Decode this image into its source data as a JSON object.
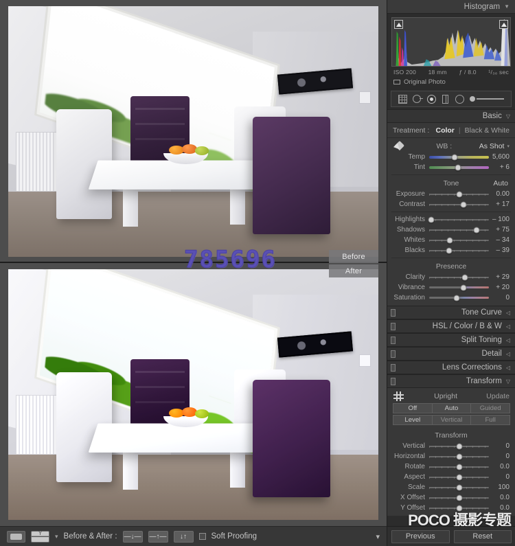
{
  "histogram": {
    "title": "Histogram",
    "collapse_icon": "triangle-down-icon",
    "clip_shadow_icon": "shadow-clipping-icon",
    "clip_highlight_icon": "highlight-clipping-icon",
    "exif": {
      "iso": "ISO 200",
      "focal_length": "18 mm",
      "aperture": "ƒ / 8.0",
      "shutter": "¹/₃₆ sec"
    },
    "original_photo_label": "Original Photo",
    "original_photo_icon": "rectangle-icon"
  },
  "tool_strip": [
    {
      "name": "crop-overlay-icon",
      "glyph": "grid"
    },
    {
      "name": "spot-removal-icon",
      "glyph": "circle-arrow"
    },
    {
      "name": "red-eye-correction-icon",
      "glyph": "dot-circle"
    },
    {
      "name": "graduated-filter-icon",
      "glyph": "split-rect"
    },
    {
      "name": "radial-filter-icon",
      "glyph": "circle"
    },
    {
      "name": "adjustment-brush-icon",
      "glyph": "brush-slider"
    }
  ],
  "basic": {
    "title": "Basic",
    "treatment_label": "Treatment :",
    "treatment_color": "Color",
    "treatment_bw": "Black & White",
    "treatment_selected": "Color",
    "wb_label": "WB :",
    "wb_value": "As Shot",
    "eyedropper_icon": "eyedropper-icon",
    "white_balance": [
      {
        "label": "Temp",
        "value": "5,600",
        "pos": 42,
        "track": "temp"
      },
      {
        "label": "Tint",
        "value": "+ 6",
        "pos": 48,
        "track": "tint"
      }
    ],
    "tone_title": "Tone",
    "auto_label": "Auto",
    "tone": [
      {
        "label": "Exposure",
        "value": "0.00",
        "pos": 50
      },
      {
        "label": "Contrast",
        "value": "+ 17",
        "pos": 58
      }
    ],
    "tone2": [
      {
        "label": "Highlights",
        "value": "– 100",
        "pos": 3
      },
      {
        "label": "Shadows",
        "value": "+ 75",
        "pos": 79
      },
      {
        "label": "Whites",
        "value": "– 34",
        "pos": 35
      },
      {
        "label": "Blacks",
        "value": "– 39",
        "pos": 33
      }
    ],
    "presence_title": "Presence",
    "presence": [
      {
        "label": "Clarity",
        "value": "+ 29",
        "pos": 60,
        "track": ""
      },
      {
        "label": "Vibrance",
        "value": "+ 20",
        "pos": 57,
        "track": "vib"
      },
      {
        "label": "Saturation",
        "value": "0",
        "pos": 46,
        "track": "sat"
      }
    ]
  },
  "sections": [
    {
      "name": "tone-curve",
      "title": "Tone Curve",
      "arrow": "◁"
    },
    {
      "name": "hsl-color-bw",
      "title": "HSL / Color / B & W",
      "arrow": "◁"
    },
    {
      "name": "split-toning",
      "title": "Split Toning",
      "arrow": "◁"
    },
    {
      "name": "detail",
      "title": "Detail",
      "arrow": "◁"
    },
    {
      "name": "lens-corrections",
      "title": "Lens Corrections",
      "arrow": "◁"
    },
    {
      "name": "transform",
      "title": "Transform",
      "arrow": "▽"
    }
  ],
  "transform": {
    "upright_label": "Upright",
    "update_label": "Update",
    "upright_icon": "upright-grid-icon",
    "buttons_row1": [
      "Off",
      "Auto",
      "Guided"
    ],
    "buttons_row2": [
      "Level",
      "Vertical",
      "Full"
    ],
    "group_title": "Transform",
    "sliders": [
      {
        "label": "Vertical",
        "value": "0",
        "pos": 50
      },
      {
        "label": "Horizontal",
        "value": "0",
        "pos": 50
      },
      {
        "label": "Rotate",
        "value": "0.0",
        "pos": 50
      },
      {
        "label": "Aspect",
        "value": "0",
        "pos": 50
      },
      {
        "label": "Scale",
        "value": "100",
        "pos": 50
      },
      {
        "label": "X Offset",
        "value": "0.0",
        "pos": 50
      },
      {
        "label": "Y Offset",
        "value": "0.0",
        "pos": 50
      }
    ]
  },
  "footer": {
    "previous_label": "Previous",
    "reset_label": "Reset"
  },
  "toolbar": {
    "loupe_view_icon": "loupe-view-icon",
    "before_after_view_icon": "before-after-split-icon",
    "view_caret_icon": "chevron-down-icon",
    "before_after_label": "Before & After :",
    "copy_before_icon": "copy-after-to-before-icon",
    "copy_after_icon": "copy-before-to-after-icon",
    "swap_icon": "swap-before-after-icon",
    "soft_proofing_label": "Soft Proofing",
    "soft_proofing_checked": false,
    "toolbar_caret_icon": "chevron-down-icon"
  },
  "image_area": {
    "before_label": "Before",
    "after_label": "After",
    "watermark": "785696"
  },
  "poco": {
    "brand": "POCO 摄影专题",
    "url": "http://photo.poco.cn/"
  },
  "colors": {
    "panel_bg": "#2c2c2c",
    "body_bg": "#383838",
    "image_bg": "#4d4d4d",
    "text": "#b6b6b6",
    "watermark": "#5a50b4"
  }
}
